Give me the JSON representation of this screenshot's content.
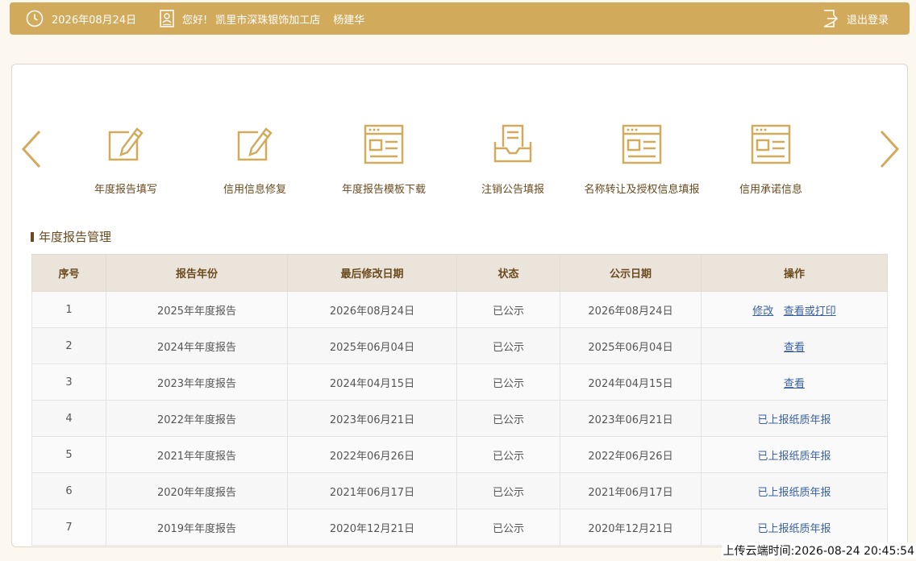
{
  "topbar": {
    "date": "2026年08月24日",
    "greeting": "您好!",
    "company": "凯里市深珠银饰加工店",
    "user": "杨建华",
    "logout": "退出登录"
  },
  "menu": [
    {
      "label": "年度报告填写",
      "icon": "edit-icon"
    },
    {
      "label": "信用信息修复",
      "icon": "edit-icon"
    },
    {
      "label": "年度报告模板下载",
      "icon": "document-icon"
    },
    {
      "label": "注销公告填报",
      "icon": "inbox-icon"
    },
    {
      "label": "名称转让及授权信息填报",
      "icon": "document-icon"
    },
    {
      "label": "信用承诺信息",
      "icon": "document-icon"
    }
  ],
  "section": {
    "title": "年度报告管理"
  },
  "table": {
    "headers": [
      "序号",
      "报告年份",
      "最后修改日期",
      "状态",
      "公示日期",
      "操作"
    ],
    "rows": [
      {
        "no": "1",
        "year": "2025年年度报告",
        "modified": "2026年08月24日",
        "status": "已公示",
        "published": "2026年08月24日",
        "ops": [
          "修改",
          "查看或打印"
        ]
      },
      {
        "no": "2",
        "year": "2024年年度报告",
        "modified": "2025年06月04日",
        "status": "已公示",
        "published": "2025年06月04日",
        "ops": [
          "查看"
        ]
      },
      {
        "no": "3",
        "year": "2023年年度报告",
        "modified": "2024年04月15日",
        "status": "已公示",
        "published": "2024年04月15日",
        "ops": [
          "查看"
        ]
      },
      {
        "no": "4",
        "year": "2022年年度报告",
        "modified": "2023年06月21日",
        "status": "已公示",
        "published": "2023年06月21日",
        "plain": "已上报纸质年报"
      },
      {
        "no": "5",
        "year": "2021年年度报告",
        "modified": "2022年06月26日",
        "status": "已公示",
        "published": "2022年06月26日",
        "plain": "已上报纸质年报"
      },
      {
        "no": "6",
        "year": "2020年年度报告",
        "modified": "2021年06月17日",
        "status": "已公示",
        "published": "2021年06月17日",
        "plain": "已上报纸质年报"
      },
      {
        "no": "7",
        "year": "2019年年度报告",
        "modified": "2020年12月21日",
        "status": "已公示",
        "published": "2020年12月21日",
        "plain": "已上报纸质年报"
      }
    ]
  },
  "footer": {
    "upload_time": "上传云端时间:2026-08-24 20:45:54"
  },
  "colors": {
    "gold": "#d2aa5c",
    "brown": "#6b4a1f",
    "link": "#3a61a8"
  }
}
